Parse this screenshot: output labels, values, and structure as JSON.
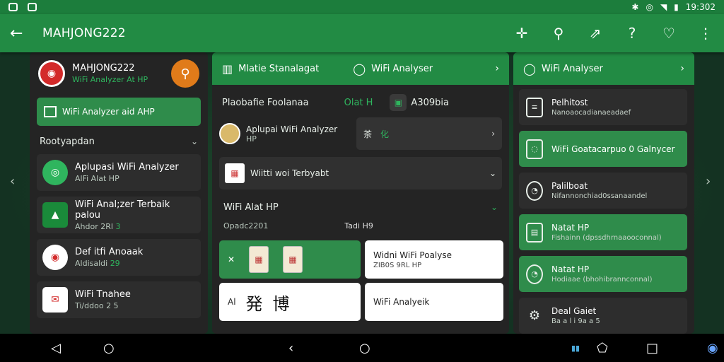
{
  "status_bar": {
    "time": "19:302",
    "left_icons": [
      "notification-icon",
      "message-icon"
    ],
    "right_icons": [
      "bluetooth-icon",
      "alarm-icon",
      "wifi-icon",
      "battery-icon"
    ]
  },
  "app_bar": {
    "title": "MAHJONG222",
    "actions": [
      "move-icon",
      "search-icon",
      "share-icon",
      "help-icon",
      "heart-icon",
      "more-icon"
    ]
  },
  "panel_left": {
    "app_name": "MAHJONG222",
    "app_sub": "WiFi Analyzer At HP",
    "primary_button": "WiFi Analyzer aid AHP",
    "section": "Rootyapdan",
    "items": [
      {
        "title": "Aplupasi WiFi Analyzer",
        "subtitle": "AlFi Alat HP",
        "badge": "",
        "color": "#2fb55e"
      },
      {
        "title": "WiFi Anal;zer Terbaik palou",
        "subtitle": "Ahdor 2Rl",
        "badge": "3",
        "color": "#1a8a3a"
      },
      {
        "title": "Def itfi Anoaak",
        "subtitle": "Aldisaldi",
        "badge": "29",
        "color": "#d32a2a"
      },
      {
        "title": "WiFi Tnahee",
        "subtitle": "Ti/ddoo 2 5",
        "badge": "",
        "color": "#d32a2a"
      }
    ]
  },
  "panel_center": {
    "tabs": [
      {
        "label": "Mlatie Stanalagat",
        "icon": "building-icon"
      },
      {
        "label": "WiFi Analyser",
        "icon": "chat-icon"
      }
    ],
    "row_left": "Plaobafie Foolanaa",
    "row_mid": "Olat H",
    "row_right": "A309bia",
    "app_title": "Aplupai WiFi Analyzer",
    "app_sub": "HP",
    "mini_label": "茶",
    "mini_g": "化",
    "best_label": "Wiitti woi Terbyabt",
    "section_title": "WiFi Alat HP",
    "section_sub": "Opadc2201",
    "section_right": "Tadi H9",
    "grid": {
      "g1": "✕",
      "g2_title": "Widni WiFi Poalyse",
      "g2_sub": "ZIB0S 9RL HP",
      "g3_prefix": "Al",
      "g3_c1": "発",
      "g3_c2": "博",
      "g4": "WiFi Analyeik"
    }
  },
  "panel_right": {
    "tab": "WiFi Analyser",
    "items": [
      {
        "title": "Pelhitost",
        "subtitle": "Nanoaocadianaeadaef",
        "highlight": false
      },
      {
        "title": "WiFi Goatacarpuo 0 Galnycer",
        "subtitle": "",
        "highlight": true
      },
      {
        "title": "Palilboat",
        "subtitle": "Nifannonchiad0ssanaandel",
        "highlight": false
      },
      {
        "title": "Natat HP",
        "subtitle": "Fishainn (dpssdhrnaaooconnal)",
        "highlight": true
      },
      {
        "title": "Natat HP",
        "subtitle": "Hodiaae (bhohibrannconnal)",
        "highlight": true
      },
      {
        "title": "Deal Gaiet",
        "subtitle": "Ba a l i 9a a 5",
        "highlight": false
      }
    ]
  },
  "nav_bar": {
    "buttons": [
      "back-icon",
      "home-icon",
      "back-icon",
      "home-icon",
      "recents-icon",
      "shape-icon",
      "square-icon",
      "assistant-icon"
    ]
  }
}
